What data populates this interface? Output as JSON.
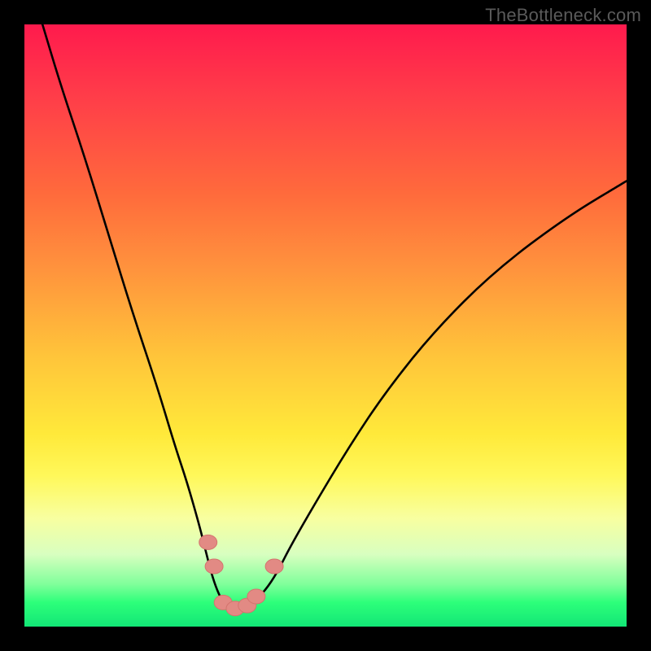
{
  "watermark": "TheBottleneck.com",
  "palette": {
    "background": "#000000",
    "gradient_top": "#ff1a4d",
    "gradient_mid": "#ffe93a",
    "gradient_bottom": "#12e676",
    "curve_stroke": "#000000",
    "marker_fill": "#e28a84",
    "marker_stroke": "#d4746e"
  },
  "chart_data": {
    "type": "line",
    "title": "",
    "xlabel": "",
    "ylabel": "",
    "xlim": [
      0,
      100
    ],
    "ylim": [
      0,
      100
    ],
    "grid": false,
    "legend": null,
    "note": "Axes unlabeled in source image; values are read from pixel proportions on a 0–100 scale. Curve shows a V-shaped valley near x≈34, with background colored by y from red (high y) through yellow to green (low y).",
    "series": [
      {
        "name": "bottleneck-curve",
        "x": [
          3,
          6,
          10,
          14,
          18,
          22,
          25,
          27,
          29,
          30,
          31,
          32,
          33,
          34,
          36,
          38,
          40,
          42,
          44,
          48,
          54,
          60,
          68,
          78,
          90,
          100
        ],
        "y": [
          100,
          90,
          78,
          65,
          52,
          40,
          30,
          24,
          17,
          13,
          9,
          6,
          4,
          3,
          3,
          4,
          6,
          9,
          13,
          20,
          30,
          39,
          49,
          59,
          68,
          74
        ]
      }
    ],
    "markers": [
      {
        "name": "left-marker-upper",
        "x": 30.5,
        "y": 14
      },
      {
        "name": "left-marker-lower",
        "x": 31.5,
        "y": 10
      },
      {
        "name": "valley-left",
        "x": 33.0,
        "y": 4
      },
      {
        "name": "valley-mid",
        "x": 35.0,
        "y": 3
      },
      {
        "name": "valley-right-1",
        "x": 37.0,
        "y": 3.5
      },
      {
        "name": "valley-right-2",
        "x": 38.5,
        "y": 5
      },
      {
        "name": "right-marker-upper",
        "x": 41.5,
        "y": 10
      }
    ]
  }
}
